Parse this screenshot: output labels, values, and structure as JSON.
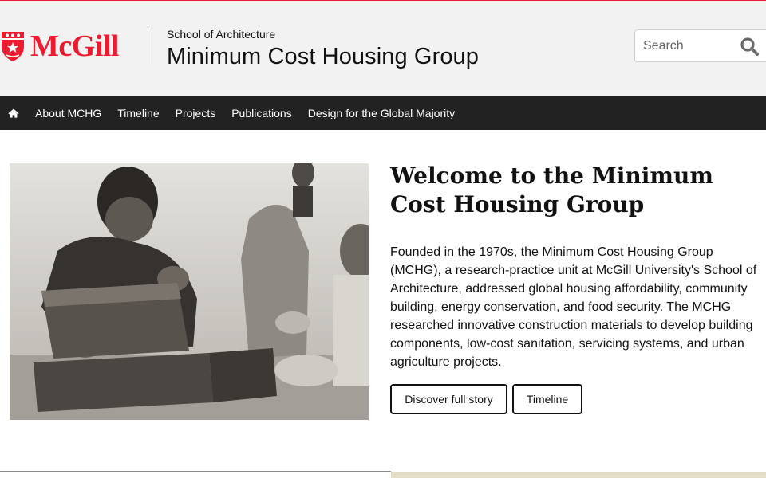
{
  "header": {
    "logo_text": "McGill",
    "school": "School of Architecture",
    "title": "Minimum Cost Housing Group"
  },
  "search": {
    "placeholder": "Search",
    "icon": "search-icon"
  },
  "nav": {
    "home_icon": "home-icon",
    "items": [
      {
        "label": "About MCHG"
      },
      {
        "label": "Timeline"
      },
      {
        "label": "Projects"
      },
      {
        "label": "Publications"
      },
      {
        "label": "Design for the Global Majority"
      }
    ]
  },
  "main": {
    "heading": "Welcome to the Minimum Cost Housing Group",
    "intro": "Founded in the 1970s, the Minimum Cost Housing Group (MCHG), a research-practice unit at McGill University's School of Architecture, addressed global housing affordability, community building, energy conservation, and food security. The MCHG researched innovative construction materials to develop building components, low-cost sanitation, servicing systems, and urban agriculture projects.",
    "buttons": {
      "story": "Discover full story",
      "timeline": "Timeline"
    }
  },
  "colors": {
    "brand_red": "#ed1b2f",
    "nav_bg": "#222222",
    "header_bg": "#f2f2f2"
  }
}
